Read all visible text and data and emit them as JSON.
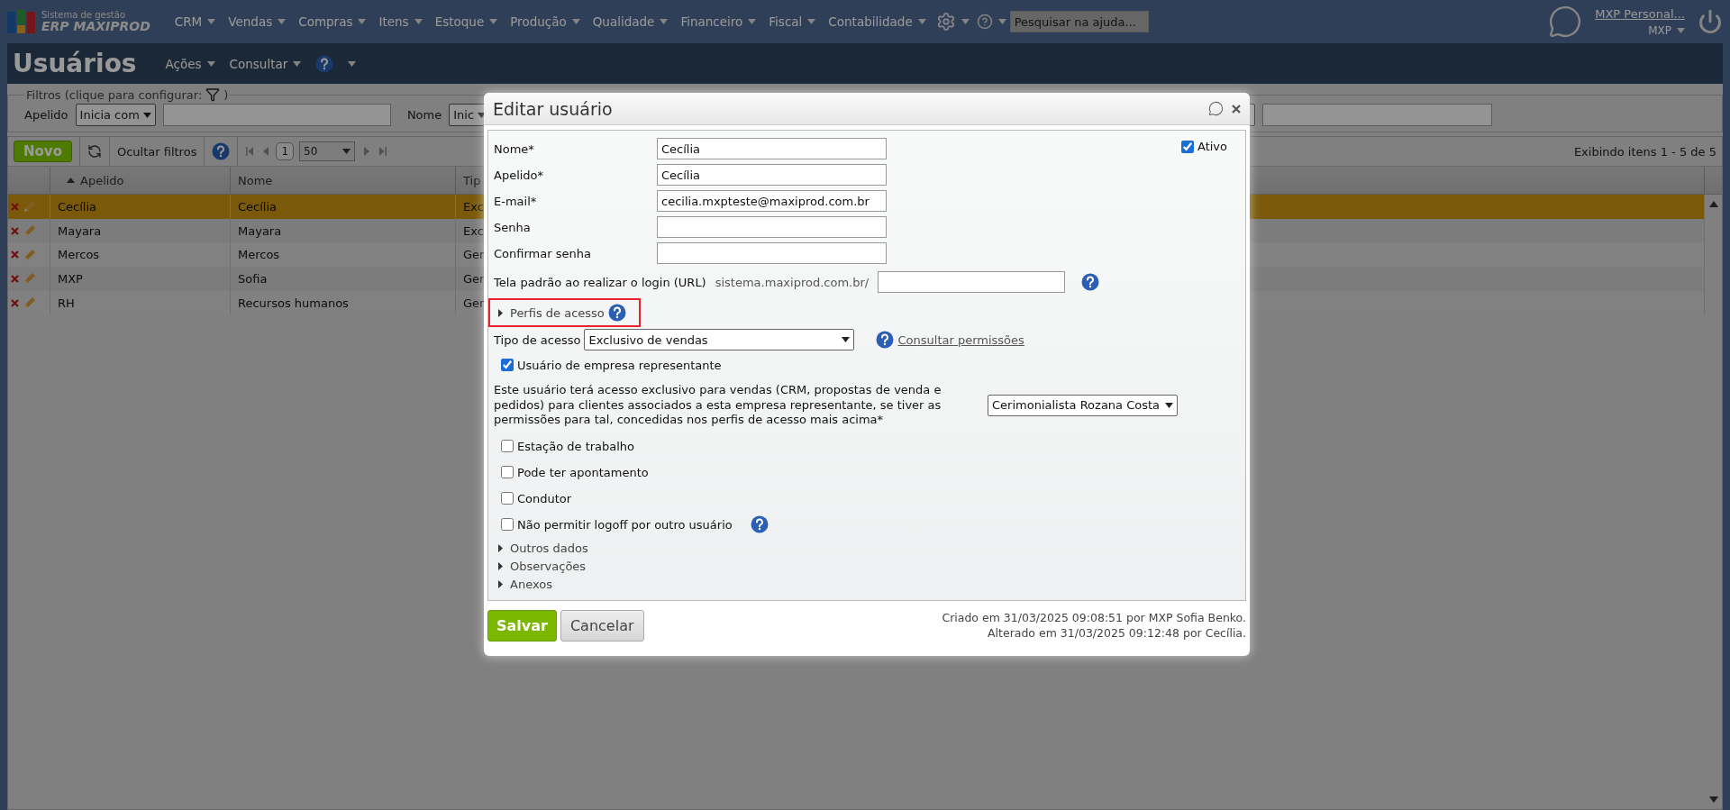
{
  "top_nav": {
    "logo": {
      "line1": "Sistema de gestão",
      "line2": "ERP MAXIPROD"
    },
    "menus": [
      "CRM",
      "Vendas",
      "Compras",
      "Itens",
      "Estoque",
      "Produção",
      "Qualidade",
      "Financeiro",
      "Fiscal",
      "Contabilidade"
    ],
    "search": {
      "placeholder": "Pesquisar na ajuda..."
    },
    "user": {
      "name": "MXP Personal...",
      "company": "MXP"
    }
  },
  "page": {
    "title": "Usuários",
    "actions": [
      "Ações",
      "Consultar"
    ]
  },
  "filters": {
    "legend_start": "Filtros (clique para configurar:",
    "legend_end": ")",
    "fields": [
      {
        "label": "Apelido",
        "operator": "Inicia com"
      },
      {
        "label": "Nome",
        "operator": "Inic"
      }
    ]
  },
  "toolbar": {
    "new_button": "Novo",
    "hide_filters": "Ocultar filtros",
    "page": "1",
    "page_size": "50",
    "summary": "Exibindo itens 1 - 5 de 5"
  },
  "table": {
    "columns": [
      {
        "label": "Apelido",
        "sorted": true
      },
      {
        "label": "Nome",
        "sorted": false
      },
      {
        "label": "Tip",
        "sorted": false
      }
    ],
    "rows": [
      {
        "cells": [
          "Cecília",
          "Cecília",
          "Exc"
        ],
        "selected": true
      },
      {
        "cells": [
          "Mayara",
          "Mayara",
          "Exc"
        ],
        "selected": false
      },
      {
        "cells": [
          "Mercos",
          "Mercos",
          "Ger"
        ],
        "selected": false
      },
      {
        "cells": [
          "MXP",
          "Sofia",
          "Ger"
        ],
        "selected": false
      },
      {
        "cells": [
          "RH",
          "Recursos humanos",
          "Ger"
        ],
        "selected": false
      }
    ]
  },
  "dialog": {
    "title": "Editar usuário",
    "active": {
      "label": "Ativo",
      "checked": true
    },
    "fields": [
      {
        "label": "Nome*",
        "value": "Cecília"
      },
      {
        "label": "Apelido*",
        "value": "Cecília"
      },
      {
        "label": "E-mail*",
        "value": "cecilia.mxpteste@maxiprod.com.br"
      },
      {
        "label": "Senha"
      },
      {
        "label": "Confirmar senha"
      }
    ],
    "login_url": {
      "label": "Tela padrão ao realizar o login (URL)",
      "prefix": "sistema.maxiprod.com.br/"
    },
    "profiles_section": {
      "label": "Perfis de acesso",
      "expanded": false,
      "highlighted": true
    },
    "access_type": {
      "label": "Tipo de acesso",
      "value": "Exclusivo de vendas",
      "link": "Consultar permissões"
    },
    "representative": {
      "label": "Usuário de empresa representante",
      "checked": true,
      "note": "Este usuário terá acesso exclusivo para vendas (CRM, propostas de venda e pedidos) para clientes associados a esta empresa representante, se tiver as permissões para tal, concedidas nos perfis de acesso mais acima*",
      "company": "Cerimonialista Rozana Costa"
    },
    "options": [
      {
        "label": "Estação de trabalho",
        "checked": false,
        "help": false
      },
      {
        "label": "Pode ter apontamento",
        "checked": false,
        "help": false
      },
      {
        "label": "Condutor",
        "checked": false,
        "help": false
      },
      {
        "label": "Não permitir logoff por outro usuário",
        "checked": false,
        "help": true
      }
    ],
    "sections": [
      {
        "label": "Outros dados",
        "expanded": false
      },
      {
        "label": "Observações",
        "expanded": false
      },
      {
        "label": "Anexos",
        "expanded": false
      }
    ],
    "buttons": {
      "save": "Salvar",
      "cancel": "Cancelar"
    },
    "audit": [
      "Criado em 31/03/2025 09:08:51 por MXP Sofia Benko.",
      "Alterado em 31/03/2025 09:12:48 por Cecília."
    ]
  }
}
